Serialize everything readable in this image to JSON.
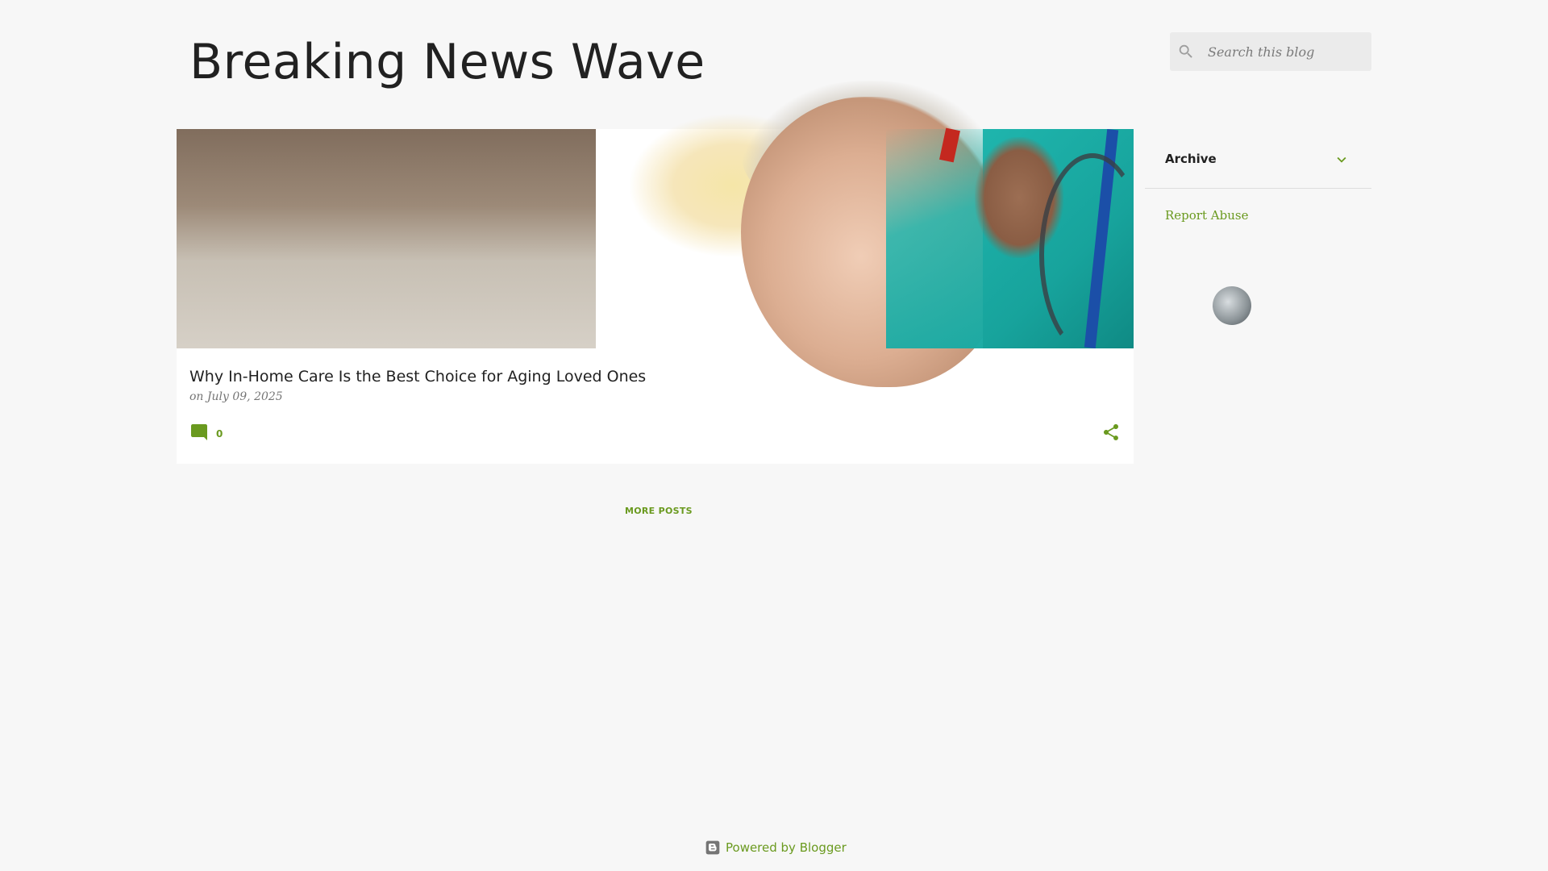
{
  "header": {
    "blog_title": "Breaking News Wave"
  },
  "search": {
    "placeholder": "Search this blog",
    "value": ""
  },
  "post": {
    "title": "Why In-Home Care Is the Best Choice for Aging Loved Ones",
    "date_prefix": "on",
    "date": "July 09, 2025",
    "comment_count": "0"
  },
  "pagination": {
    "more_posts_label": "MORE POSTS"
  },
  "sidebar": {
    "archive_title": "Archive",
    "report_abuse_label": "Report Abuse"
  },
  "footer": {
    "powered_by_label": "Powered by Blogger"
  },
  "icons": {
    "search": "search-icon",
    "comment": "comment-icon",
    "share": "share-icon",
    "chevron": "chevron-down-icon",
    "blogger": "blogger-icon"
  },
  "colors": {
    "accent": "#6a9a1f",
    "page_background": "#f7f7f7",
    "card_background": "#ffffff",
    "search_background": "#ebebeb",
    "title_text": "#212121",
    "muted_text": "#757575"
  }
}
